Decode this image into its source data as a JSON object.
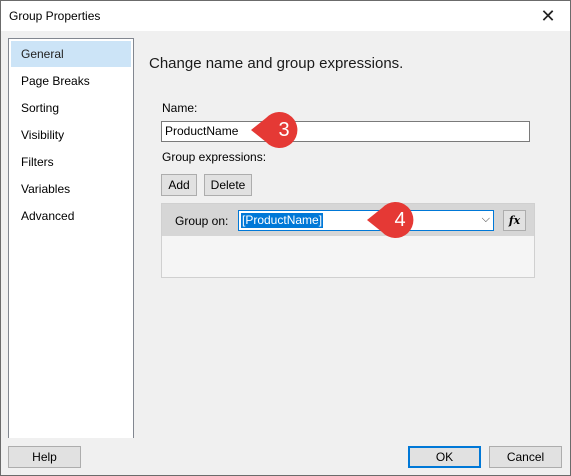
{
  "window": {
    "title": "Group Properties"
  },
  "sidebar": {
    "items": [
      {
        "label": "General",
        "selected": true
      },
      {
        "label": "Page Breaks"
      },
      {
        "label": "Sorting"
      },
      {
        "label": "Visibility"
      },
      {
        "label": "Filters"
      },
      {
        "label": "Variables"
      },
      {
        "label": "Advanced"
      }
    ]
  },
  "main": {
    "heading": "Change name and group expressions.",
    "name_label": "Name:",
    "name_value": "ProductName",
    "group_expr_label": "Group expressions:",
    "add_label": "Add",
    "delete_label": "Delete",
    "group_on_label": "Group on:",
    "group_on_value": "[ProductName]",
    "fx_label": "fx"
  },
  "callouts": [
    {
      "number": "3"
    },
    {
      "number": "4"
    }
  ],
  "footer": {
    "help_label": "Help",
    "ok_label": "OK",
    "cancel_label": "Cancel"
  },
  "colors": {
    "accent": "#0078d7",
    "selection": "#cce4f7",
    "callout": "#e53935"
  }
}
